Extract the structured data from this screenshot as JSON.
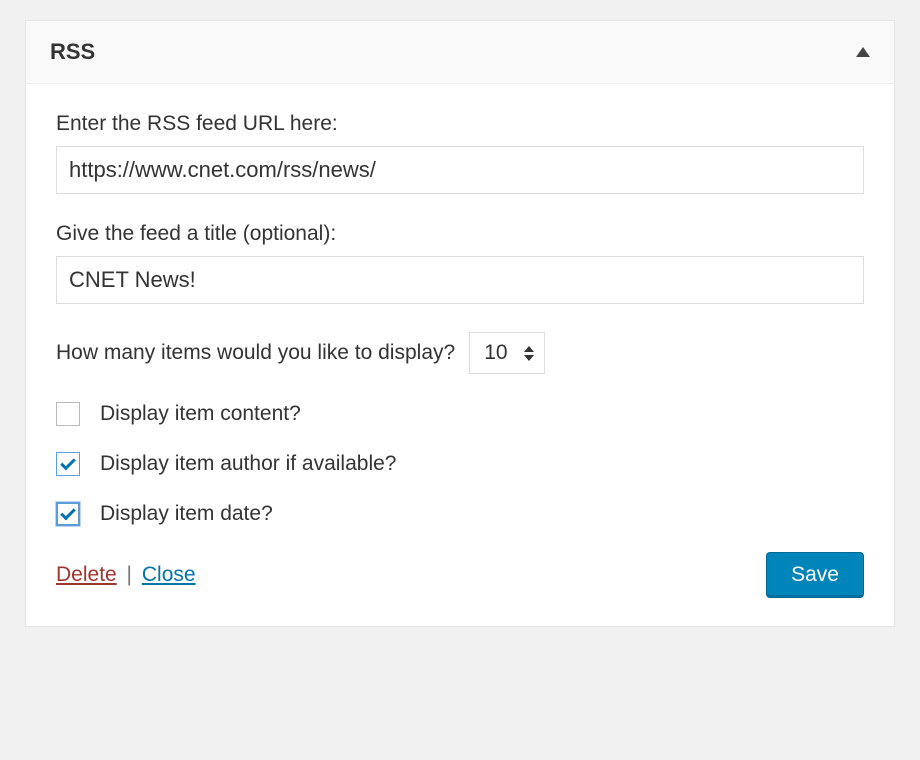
{
  "header": {
    "title": "RSS"
  },
  "fields": {
    "url": {
      "label": "Enter the RSS feed URL here:",
      "value": "https://www.cnet.com/rss/news/"
    },
    "title": {
      "label": "Give the feed a title (optional):",
      "value": "CNET News!"
    },
    "items": {
      "label": "How many items would you like to display?",
      "value": "10"
    },
    "display_content": {
      "label": "Display item content?",
      "checked": false
    },
    "display_author": {
      "label": "Display item author if available?",
      "checked": true
    },
    "display_date": {
      "label": "Display item date?",
      "checked": true
    }
  },
  "footer": {
    "delete": "Delete",
    "separator": "|",
    "close": "Close",
    "save": "Save"
  }
}
